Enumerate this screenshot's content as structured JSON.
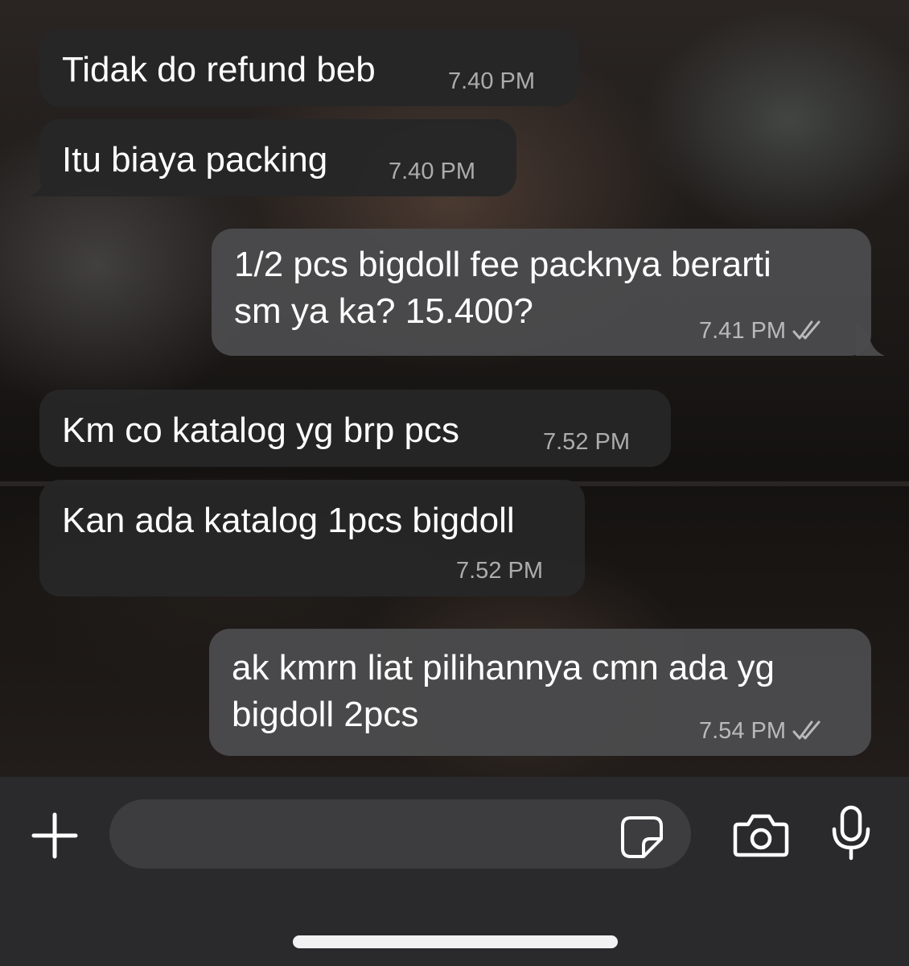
{
  "messages": [
    {
      "direction": "incoming",
      "text": "Tidak do refund beb",
      "time": "7.40 PM"
    },
    {
      "direction": "incoming",
      "text": "Itu biaya packing",
      "time": "7.40 PM"
    },
    {
      "direction": "outgoing",
      "line1": "1/2 pcs bigdoll fee packnya berarti",
      "line2": "sm ya ka? 15.400?",
      "time": "7.41 PM",
      "status": "read"
    },
    {
      "direction": "incoming",
      "text": "Km co katalog yg brp pcs",
      "time": "7.52 PM"
    },
    {
      "direction": "incoming",
      "text": "Kan ada katalog 1pcs bigdoll",
      "time": "7.52 PM"
    },
    {
      "direction": "outgoing",
      "line1": "ak kmrn liat pilihannya cmn ada yg",
      "line2": "bigdoll 2pcs",
      "time": "7.54 PM",
      "status": "read"
    }
  ],
  "composer": {
    "input_value": "",
    "icons": [
      "plus-icon",
      "sticker-icon",
      "camera-icon",
      "microphone-icon"
    ]
  },
  "colors": {
    "incoming_bubble": "#262628",
    "outgoing_bubble": "#4a4a4c",
    "composer_bg": "#2a2a2c",
    "input_bg": "#3d3d40",
    "text": "#ffffff"
  }
}
